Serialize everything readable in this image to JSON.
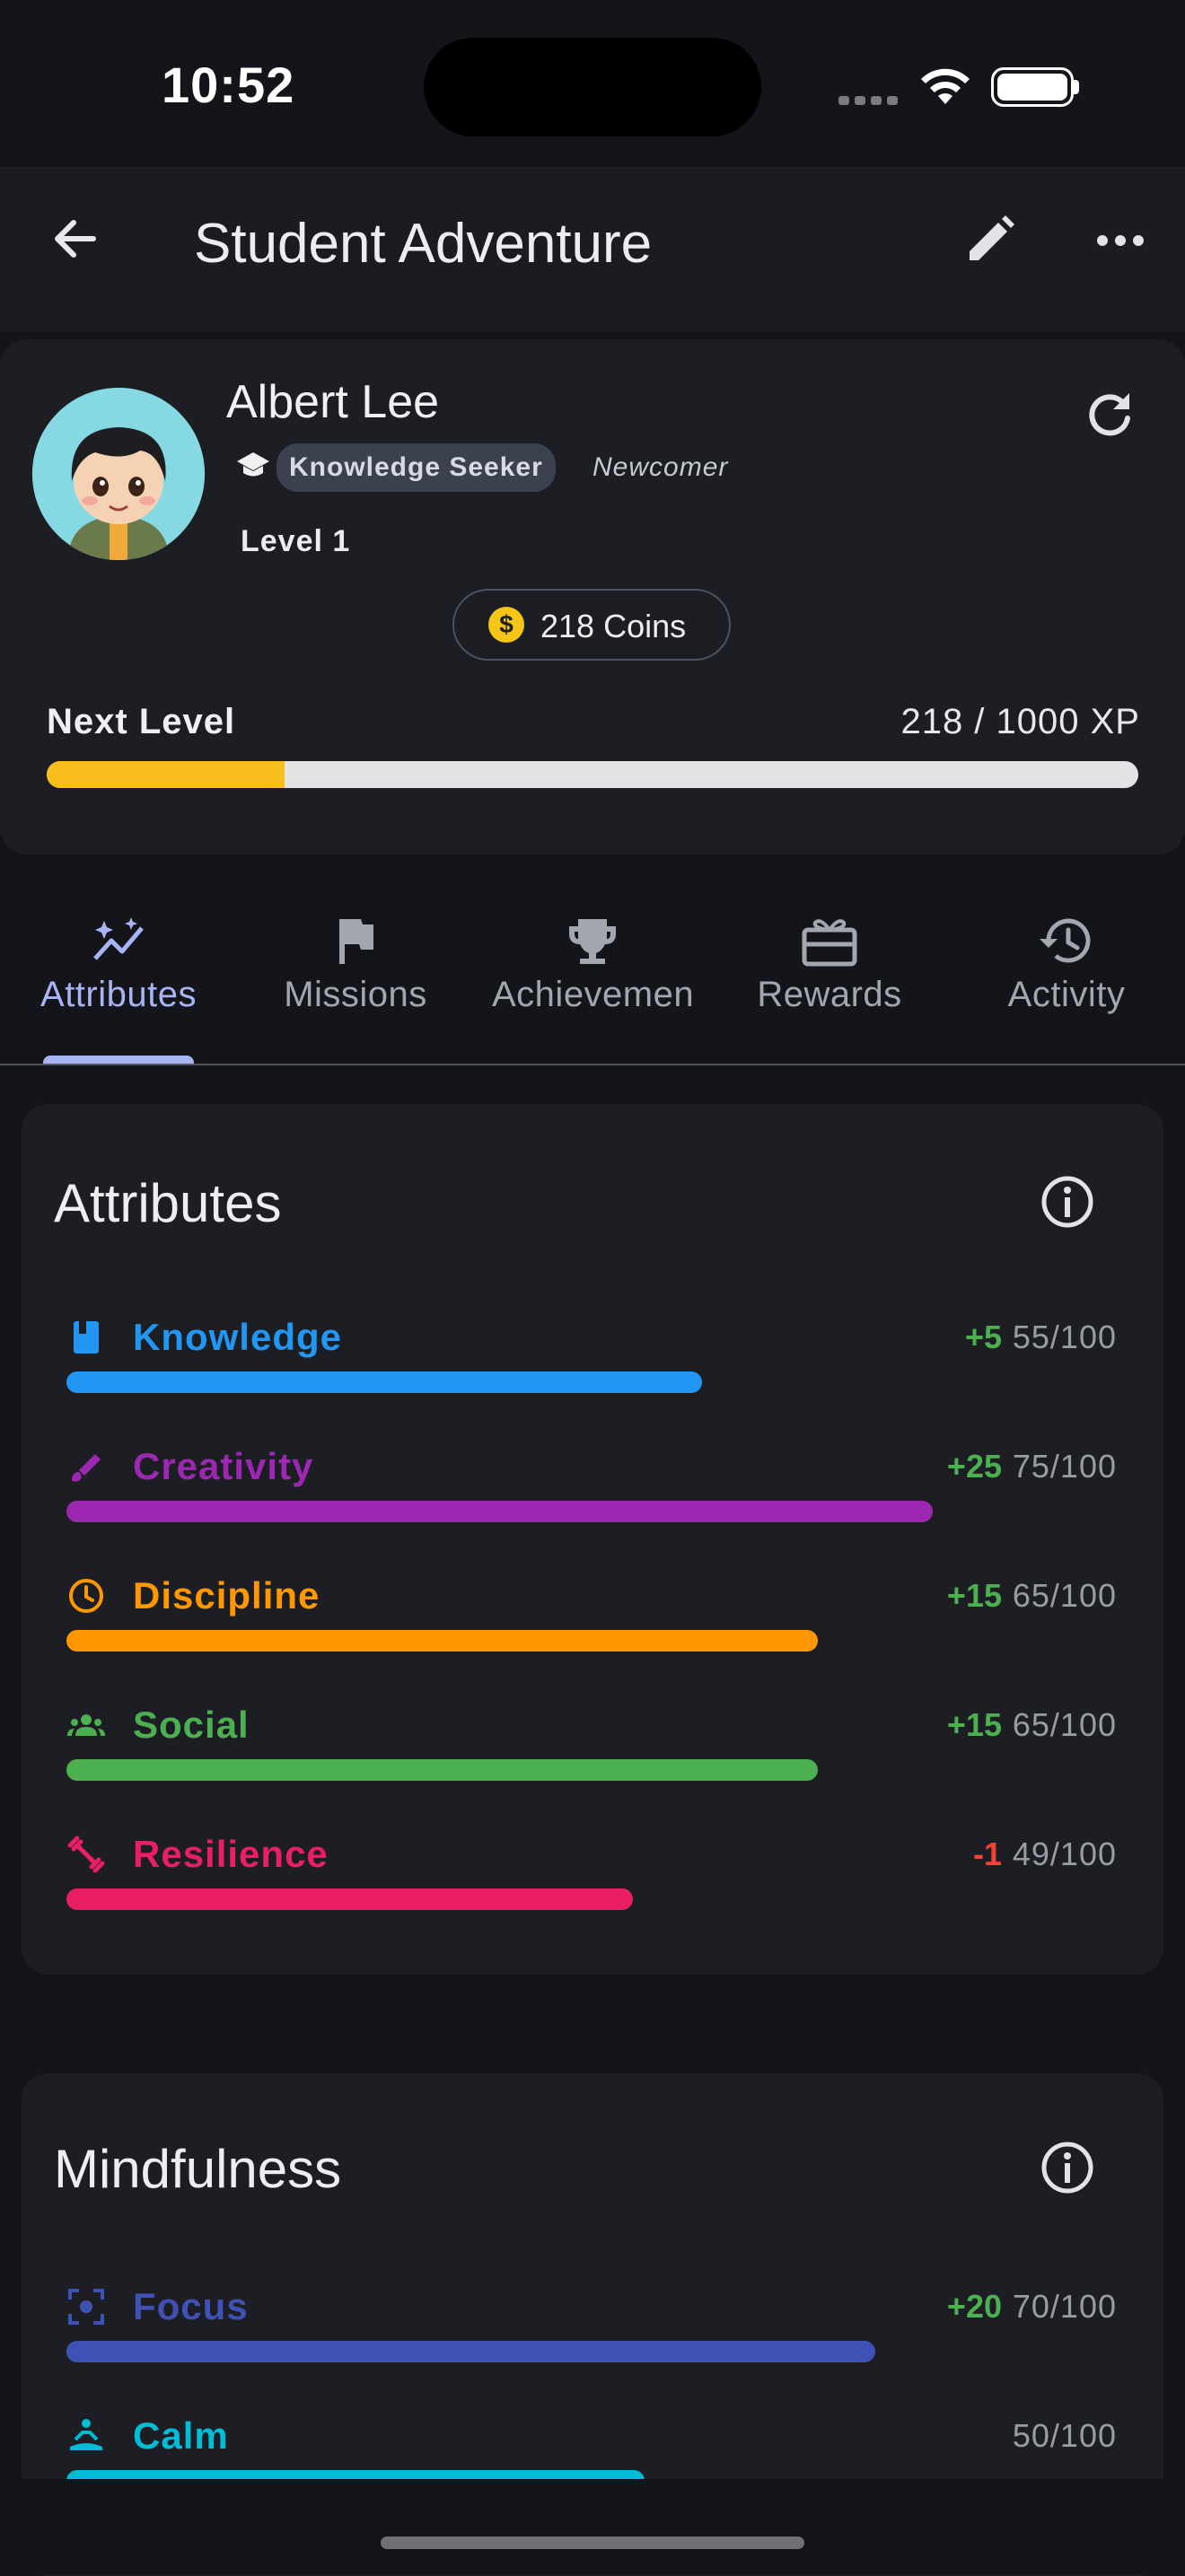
{
  "status_bar": {
    "time": "10:52"
  },
  "app_bar": {
    "title": "Student Adventure"
  },
  "profile": {
    "name": "Albert Lee",
    "title_chip": "Knowledge Seeker",
    "rank": "Newcomer",
    "level": "Level 1",
    "coins": "218 Coins",
    "next_level_label": "Next Level",
    "xp_readout": "218 / 1000 XP",
    "xp_progress": 0.218,
    "xp_color": "#f7be1c"
  },
  "tabs": [
    {
      "label": "Attributes",
      "icon": "sparkle-chart-icon",
      "active": true
    },
    {
      "label": "Missions",
      "icon": "flag-icon",
      "active": false
    },
    {
      "label": "Achievements",
      "icon": "trophy-icon",
      "active": false
    },
    {
      "label": "Rewards",
      "icon": "gift-card-icon",
      "active": false
    },
    {
      "label": "Activity",
      "icon": "history-icon",
      "active": false
    }
  ],
  "attributes_section": {
    "title": "Attributes",
    "items": [
      {
        "name": "Knowledge",
        "delta": "+5",
        "value": "55/100",
        "progress": 0.55,
        "color": "#2196f3",
        "delta_color": "#4caf50",
        "icon": "book-icon"
      },
      {
        "name": "Creativity",
        "delta": "+25",
        "value": "75/100",
        "progress": 0.75,
        "color": "#9c27b0",
        "delta_color": "#4caf50",
        "icon": "brush-icon"
      },
      {
        "name": "Discipline",
        "delta": "+15",
        "value": "65/100",
        "progress": 0.65,
        "color": "#ff9800",
        "delta_color": "#4caf50",
        "icon": "clock-icon"
      },
      {
        "name": "Social",
        "delta": "+15",
        "value": "65/100",
        "progress": 0.65,
        "color": "#4caf50",
        "delta_color": "#4caf50",
        "icon": "group-icon"
      },
      {
        "name": "Resilience",
        "delta": "-1",
        "value": "49/100",
        "progress": 0.49,
        "color": "#e91e63",
        "delta_color": "#f44336",
        "icon": "fitness-icon"
      }
    ]
  },
  "mindfulness_section": {
    "title": "Mindfulness",
    "items": [
      {
        "name": "Focus",
        "delta": "+20",
        "value": "70/100",
        "progress": 0.7,
        "color": "#3f51b5",
        "delta_color": "#4caf50",
        "icon": "focus-icon"
      },
      {
        "name": "Calm",
        "delta": "",
        "value": "50/100",
        "progress": 0.5,
        "color": "#00bcd4",
        "delta_color": "#4caf50",
        "icon": "meditation-icon"
      }
    ]
  }
}
